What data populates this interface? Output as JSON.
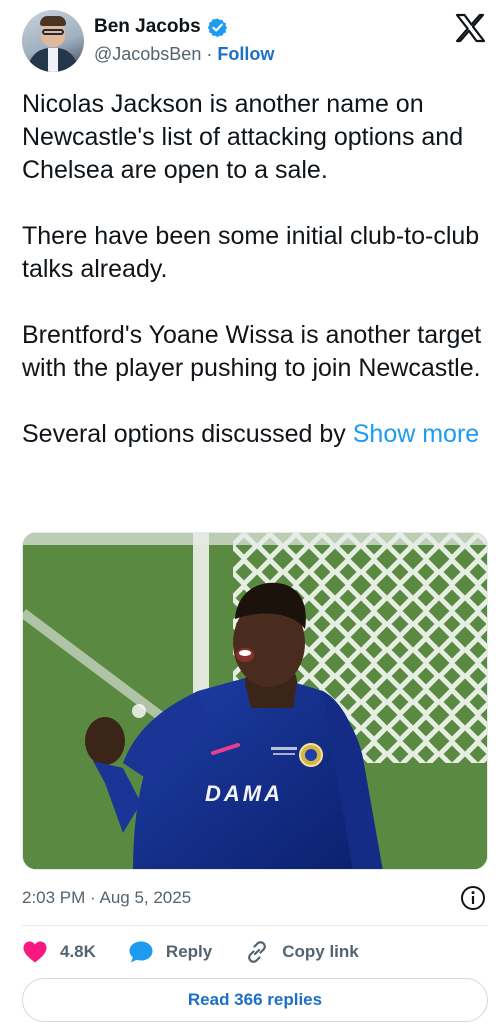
{
  "author": {
    "name": "Ben Jacobs",
    "handle": "@JacobsBen",
    "separator": "·",
    "follow_label": "Follow",
    "verified": true
  },
  "brand_icon": "x-logo-icon",
  "tweet": {
    "paragraphs": [
      "Nicolas Jackson is another name on Newcastle's list of attacking options and Chelsea are open to a sale.",
      "There have been some initial club-to-club talks already.",
      "Brentford's Yoane Wissa is another target with the player pushing to join Newcastle."
    ],
    "last_paragraph": "Several options discussed by",
    "show_more_label": "Show more"
  },
  "media": {
    "shirt_sponsor": "DAMA"
  },
  "meta": {
    "timestamp": "2:03 PM · Aug 5, 2025"
  },
  "actions": {
    "likes": "4.8K",
    "reply_label": "Reply",
    "copy_link_label": "Copy link"
  },
  "footer": {
    "read_replies_label": "Read 366 replies"
  },
  "colors": {
    "accent": "#1d9bf0",
    "link_blue": "#1d6fc7",
    "like_red": "#f91880",
    "text": "#0f1419",
    "secondary": "#536471"
  }
}
